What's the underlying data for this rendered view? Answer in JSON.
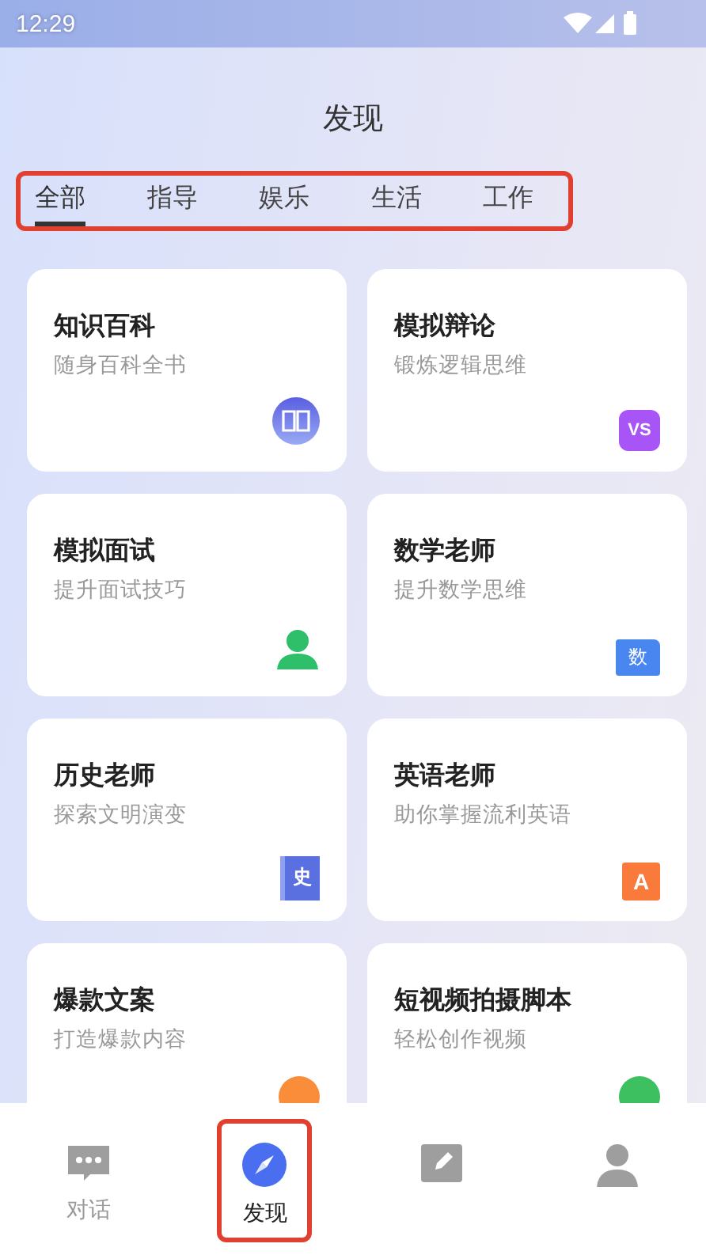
{
  "status_bar": {
    "time": "12:29"
  },
  "title": "发现",
  "tabs": [
    {
      "label": "全部",
      "selected": true
    },
    {
      "label": "指导",
      "selected": false
    },
    {
      "label": "娱乐",
      "selected": false
    },
    {
      "label": "生活",
      "selected": false
    },
    {
      "label": "工作",
      "selected": false
    }
  ],
  "cards": [
    {
      "title": "知识百科",
      "subtitle": "随身百科全书",
      "icon": {
        "kind": "book"
      }
    },
    {
      "title": "模拟辩论",
      "subtitle": "锻炼逻辑思维",
      "icon": {
        "kind": "tile",
        "glyph": "VS",
        "color": "#a855f7"
      }
    },
    {
      "title": "模拟面试",
      "subtitle": "提升面试技巧",
      "icon": {
        "kind": "person"
      }
    },
    {
      "title": "数学老师",
      "subtitle": "提升数学思维",
      "icon": {
        "kind": "folder",
        "glyph": "数",
        "color": "#4a86f0"
      }
    },
    {
      "title": "历史老师",
      "subtitle": "探索文明演变",
      "icon": {
        "kind": "volume",
        "glyph": "史",
        "color": "#5a6fe0"
      }
    },
    {
      "title": "英语老师",
      "subtitle": "助你掌握流利英语",
      "icon": {
        "kind": "notebook",
        "glyph": "A",
        "color": "#f97a3a"
      }
    },
    {
      "title": "爆款文案",
      "subtitle": "打造爆款内容",
      "icon": {
        "kind": "circle",
        "color": "#f98d3a"
      }
    },
    {
      "title": "短视频拍摄脚本",
      "subtitle": "轻松创作视频",
      "icon": {
        "kind": "circle",
        "color": "#3cc060"
      }
    }
  ],
  "nav": [
    {
      "kind": "chat",
      "label": "对话",
      "selected": false
    },
    {
      "kind": "compass",
      "label": "发现",
      "selected": true
    },
    {
      "kind": "pencil",
      "selected": false
    },
    {
      "kind": "user",
      "selected": false
    }
  ]
}
